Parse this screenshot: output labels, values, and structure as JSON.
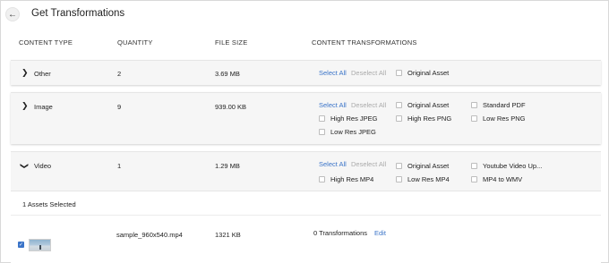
{
  "header": {
    "back_icon": "arrow-left-icon",
    "title": "Get Transformations"
  },
  "columns": {
    "content_type": "CONTENT TYPE",
    "quantity": "QUANTITY",
    "file_size": "FILE SIZE",
    "content_transformations": "CONTENT TRANSFORMATIONS"
  },
  "groups": [
    {
      "type": "Other",
      "quantity": "2",
      "file_size": "3.69 MB",
      "expanded": false,
      "select_all": "Select All",
      "deselect_all": "Deselect All",
      "options": [
        "Original Asset"
      ]
    },
    {
      "type": "Image",
      "quantity": "9",
      "file_size": "939.00 KB",
      "expanded": false,
      "select_all": "Select All",
      "deselect_all": "Deselect All",
      "options": [
        "Original Asset",
        "Standard PDF",
        "High Res JPEG",
        "High Res PNG",
        "Low Res PNG",
        "Low Res JPEG"
      ]
    },
    {
      "type": "Video",
      "quantity": "1",
      "file_size": "1.29 MB",
      "expanded": true,
      "select_all": "Select All",
      "deselect_all": "Deselect All",
      "options": [
        "Original Asset",
        "Youtube Video Up...",
        "High Res MP4",
        "Low Res MP4",
        "MP4 to WMV"
      ]
    }
  ],
  "video_details": {
    "assets_selected": "1 Assets Selected",
    "asset": {
      "selected": true,
      "file_name": "sample_960x540.mp4",
      "size": "1321 KB",
      "transformations": "0 Transformations",
      "edit_label": "Edit"
    }
  },
  "colors": {
    "accent": "#3b74c8",
    "disabled_link": "#aaaaaa",
    "panel_bg": "#f6f6f6"
  }
}
